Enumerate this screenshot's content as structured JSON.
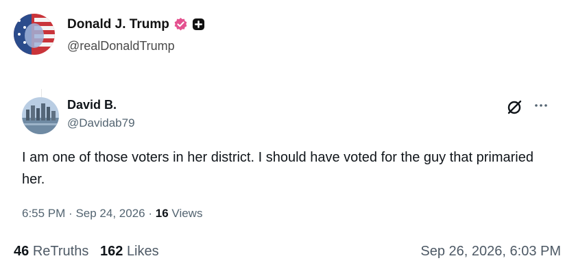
{
  "post": {
    "display_name": "Donald J. Trump",
    "handle": "@realDonaldTrump",
    "verified_color": "#e4518f"
  },
  "quoted": {
    "display_name": "David B.",
    "handle": "@Davidab79",
    "text": "I am one of those voters in her district. I should have voted for the guy that primaried her.",
    "time": "6:55 PM",
    "sep": "·",
    "date": "Sep 24, 2026",
    "views_count": "16",
    "views_label": "Views"
  },
  "stats": {
    "retruths_count": "46",
    "retruths_label": "ReTruths",
    "likes_count": "162",
    "likes_label": "Likes",
    "timestamp": "Sep 26, 2026, 6:03 PM"
  },
  "icons": {
    "verified": "verified-badge-icon",
    "plus": "plus-badge-icon",
    "grok": "grok-icon",
    "more": "more-options-icon"
  }
}
